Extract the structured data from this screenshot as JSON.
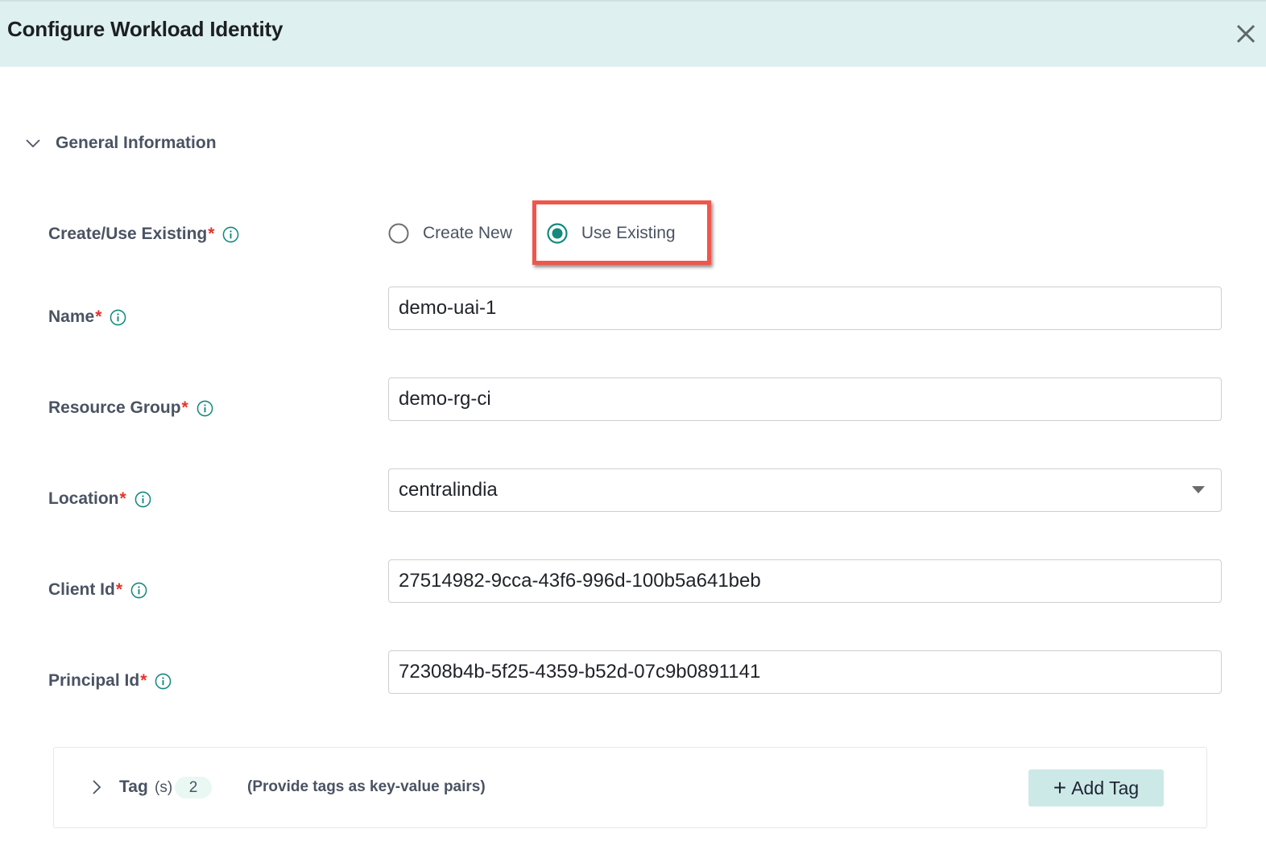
{
  "dialog": {
    "title": "Configure Workload Identity",
    "close_icon": "close-icon"
  },
  "section": {
    "title": "General Information",
    "expanded": true,
    "toggle_icon": "chevron-down-icon"
  },
  "form": {
    "create_use": {
      "label": "Create/Use Existing",
      "required_mark": "*",
      "options": [
        {
          "label": "Create New",
          "selected": false
        },
        {
          "label": "Use Existing",
          "selected": true
        }
      ],
      "highlighted_option": "Use Existing"
    },
    "name": {
      "label": "Name",
      "required_mark": "*",
      "value": "demo-uai-1"
    },
    "resource_group": {
      "label": "Resource Group",
      "required_mark": "*",
      "value": "demo-rg-ci"
    },
    "location": {
      "label": "Location",
      "required_mark": "*",
      "value": "centralindia",
      "type": "dropdown"
    },
    "client_id": {
      "label": "Client Id",
      "required_mark": "*",
      "value": "27514982-9cca-43f6-996d-100b5a641beb"
    },
    "principal_id": {
      "label": "Principal Id",
      "required_mark": "*",
      "value": "72308b4b-5f25-4359-b52d-07c9b0891141"
    }
  },
  "tags": {
    "label": "Tag",
    "suffix": "(s)",
    "count": "2",
    "hint": "(Provide tags as key-value pairs)",
    "add_button": {
      "plus": "+",
      "label": "Add Tag"
    }
  },
  "colors": {
    "header_bg": "#def1f0",
    "accent": "#13897e",
    "required": "#e5332a",
    "highlight_border": "#f2554a",
    "add_tag_bg": "#cce9e7"
  }
}
